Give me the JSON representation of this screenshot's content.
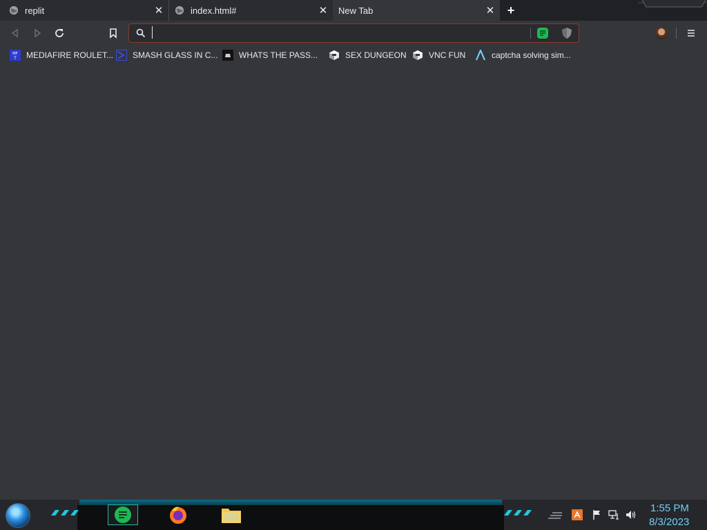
{
  "browser": {
    "tabs": [
      {
        "title": "replit",
        "close": "✕"
      },
      {
        "title": "index.html#",
        "close": "✕"
      },
      {
        "title": "New Tab",
        "close": "✕"
      }
    ],
    "new_tab_symbol": "+"
  },
  "omnibox": {
    "value": "",
    "placeholder": ""
  },
  "bookmarks": [
    {
      "label": "MEDIAFIRE ROULET...",
      "icon": "mft-icon"
    },
    {
      "label": "SMASH GLASS IN C...",
      "icon": "chevron-bookmark-icon"
    },
    {
      "label": "WHATS THE PASS...",
      "icon": "dark-square-icon"
    },
    {
      "label": "SEX DUNGEON",
      "icon": "cube-icon"
    },
    {
      "label": "VNC FUN",
      "icon": "cube-icon"
    },
    {
      "label": "captcha solving sim...",
      "icon": "lambda-icon"
    }
  ],
  "taskbar": {
    "clock_time": "1:55 PM",
    "clock_date": "8/3/2023"
  },
  "colors": {
    "background": "#35363a",
    "tabstrip": "#202124",
    "omnibox_border": "#8a3a2e",
    "clock": "#6ecff6",
    "accent_cyan": "#1dbf9a"
  }
}
